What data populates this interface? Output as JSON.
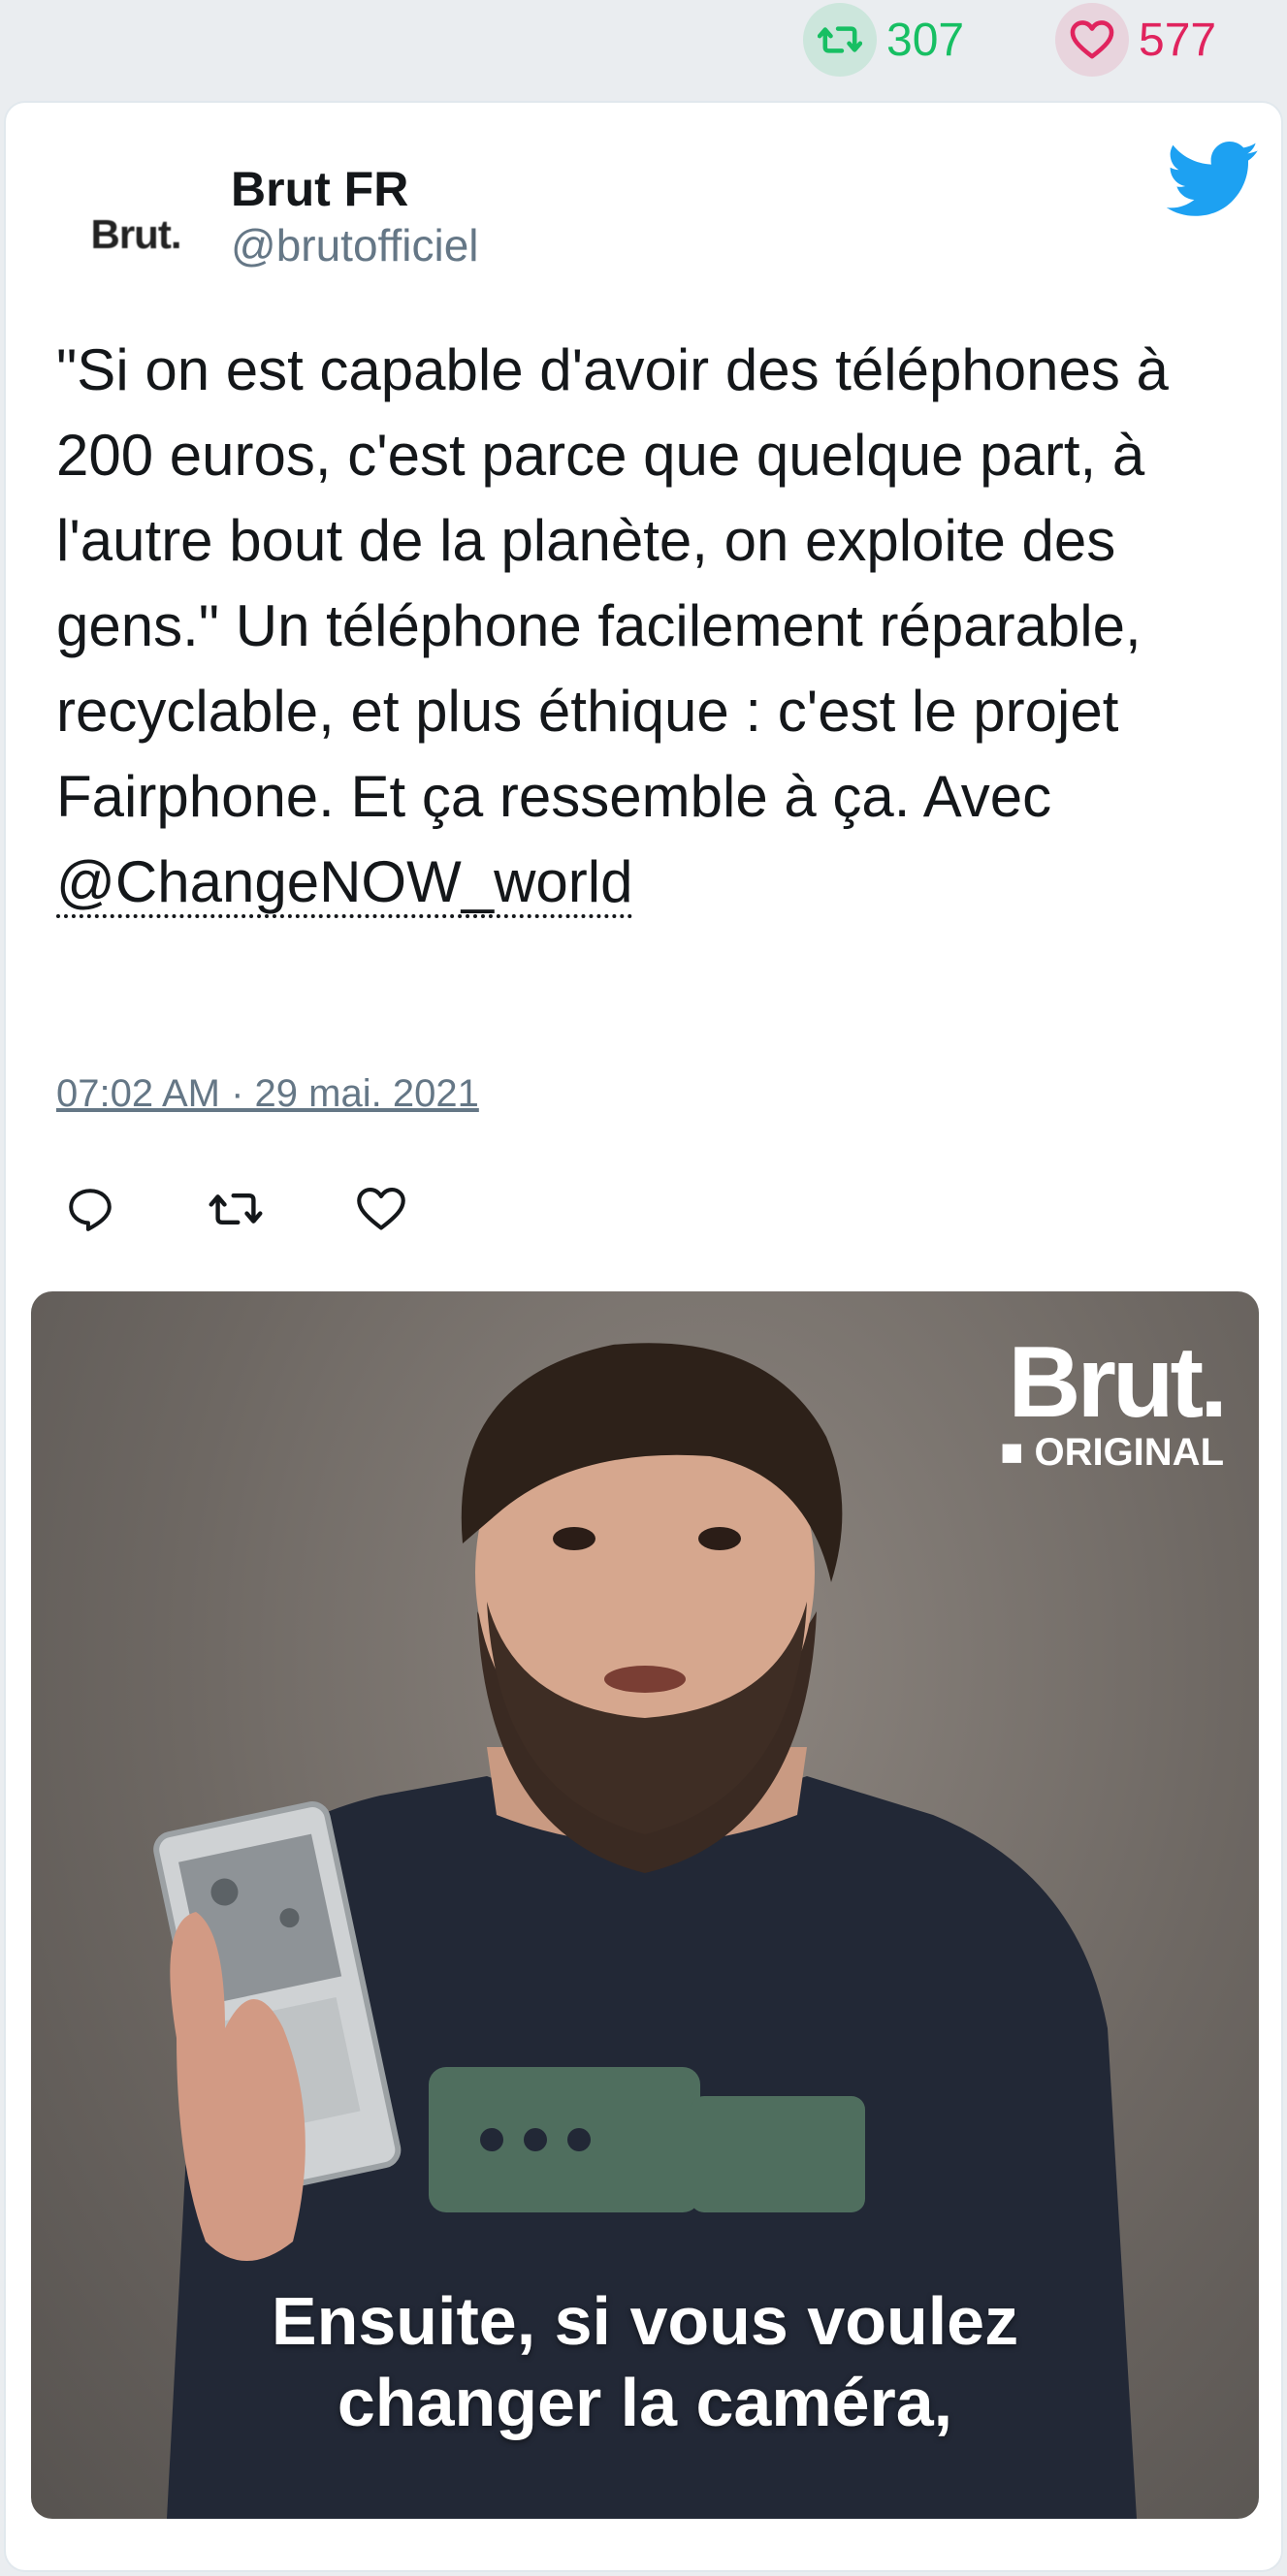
{
  "stats": {
    "retweets": "307",
    "likes": "577",
    "retweet_color": "#17bf63",
    "like_color": "#e0245e"
  },
  "tweet": {
    "author_name": "Brut FR",
    "author_handle": "@brutofficiel",
    "avatar_text": "Brut.",
    "text": "\"Si on est capable d'avoir des téléphones à 200 euros, c'est parce que quelque part, à l'autre bout de la planète, on exploite des gens.\" Un téléphone facilement réparable, recyclable, et plus éthique : c'est le projet Fairphone. Et ça ressemble à ça. Avec ",
    "mention": "@ChangeNOW_world",
    "timestamp": "07:02 AM · 29 mai. 2021",
    "icons": {
      "platform": "twitter-bird-icon",
      "reply": "reply-icon",
      "retweet": "retweet-icon",
      "like": "heart-icon"
    },
    "brand_color": "#1da1f2"
  },
  "media": {
    "logo_main": "Brut.",
    "logo_sub": "ORIGINAL",
    "subtitle_line1": "Ensuite, si vous voulez",
    "subtitle_line2": "changer la caméra,"
  }
}
